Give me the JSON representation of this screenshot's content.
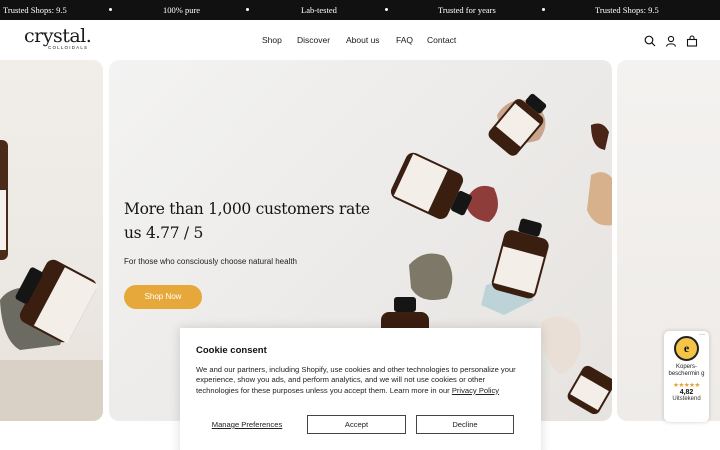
{
  "announcement": {
    "items": [
      "Trusted Shops: 9.5",
      "100% pure",
      "Lab-tested",
      "Trusted for years",
      "Trusted Shops: 9.5"
    ]
  },
  "brand": {
    "name": "crystal.",
    "tagline": "COLLOIDALS"
  },
  "nav": {
    "items": [
      "Shop",
      "Discover",
      "About us",
      "FAQ",
      "Contact"
    ]
  },
  "header_icons": [
    "search-icon",
    "account-icon",
    "cart-icon"
  ],
  "hero": {
    "title": "More than 1,000 customers rate us 4.77 / 5",
    "subtitle": "For those who consciously choose natural health",
    "cta": "Shop Now",
    "accent": "#e6a83a"
  },
  "cookie": {
    "title": "Cookie consent",
    "body": "We and our partners, including Shopify, use cookies and other technologies to personalize your experience, show you ads, and perform analytics, and we will not use cookies or other technologies for these purposes unless you accept them. Learn more in our",
    "policy_link": "Privacy Policy",
    "manage": "Manage Preferences",
    "accept": "Accept",
    "decline": "Decline"
  },
  "trust_badge": {
    "seal": "e",
    "label": "Kopers-beschermin g",
    "stars": "★★★★★",
    "score": "4,82",
    "verdict": "Uitstekend",
    "close": "—"
  }
}
